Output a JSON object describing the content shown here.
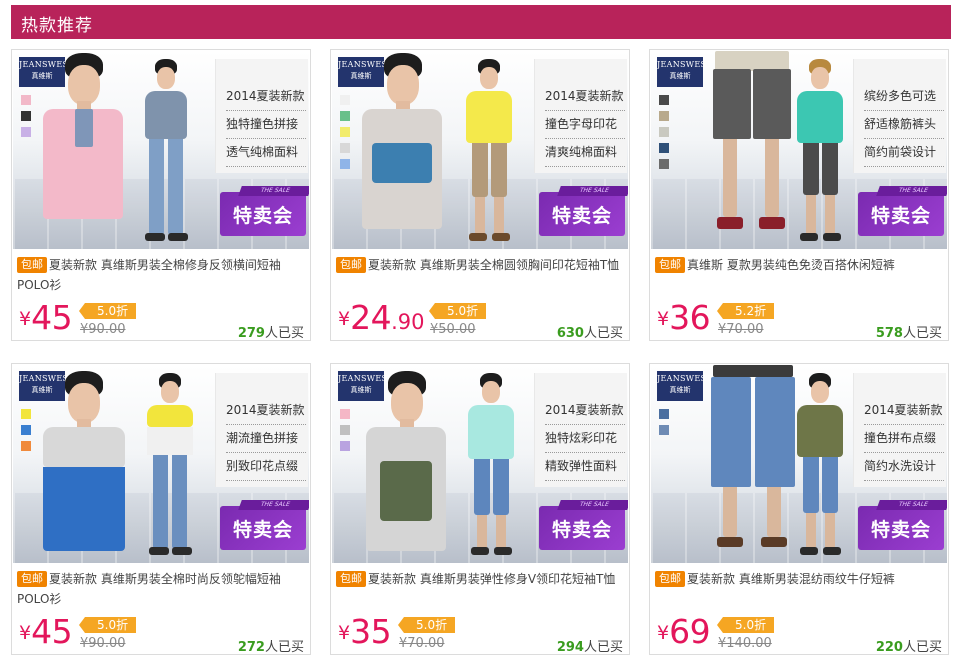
{
  "header": {
    "title": "热款推荐"
  },
  "brand": {
    "logo_line1": "JEANSWEST",
    "logo_line2": "真维斯"
  },
  "sale_badge": {
    "text": "特卖会",
    "ribbon": "THE SALE"
  },
  "products": [
    {
      "features": [
        "2014夏装新款",
        "独特撞色拼接",
        "透气纯棉面料"
      ],
      "free_shipping": "包邮",
      "title": "夏装新款 真维斯男装全棉修身反领横间短袖POLO衫",
      "price_int": "45",
      "price_dec": "",
      "currency": "¥",
      "discount": "5.0折",
      "original_price": "¥90.00",
      "sold_count": "279",
      "sold_suffix": "人已买",
      "swatches": [
        "#f2b8c8",
        "#333333",
        "#c8b0e6"
      ]
    },
    {
      "features": [
        "2014夏装新款",
        "撞色字母印花",
        "清爽纯棉面料"
      ],
      "free_shipping": "包邮",
      "title": "夏装新款 真维斯男装全棉圆领胸间印花短袖T恤",
      "price_int": "24",
      "price_dec": ".90",
      "currency": "¥",
      "discount": "5.0折",
      "original_price": "¥50.00",
      "sold_count": "630",
      "sold_suffix": "人已买",
      "swatches": [
        "#f0f0f0",
        "#69c08a",
        "#f2ec6b",
        "#d8d8d8",
        "#8fb4e8"
      ]
    },
    {
      "features": [
        "缤纷多色可选",
        "舒适橡筋裤头",
        "简约前袋设计"
      ],
      "free_shipping": "包邮",
      "title": "真维斯 夏款男装纯色免烫百搭休闲短裤",
      "price_int": "36",
      "price_dec": "",
      "currency": "¥",
      "discount": "5.2折",
      "original_price": "¥70.00",
      "sold_count": "578",
      "sold_suffix": "人已买",
      "swatches": [
        "#4a4a4a",
        "#b8a98c",
        "#c9c9c0",
        "#2f5078",
        "#6b6b6b"
      ]
    },
    {
      "features": [
        "2014夏装新款",
        "潮流撞色拼接",
        "别致印花点缀"
      ],
      "free_shipping": "包邮",
      "title": "夏装新款 真维斯男装全棉时尚反领鸵幅短袖POLO衫",
      "price_int": "45",
      "price_dec": "",
      "currency": "¥",
      "discount": "5.0折",
      "original_price": "¥90.00",
      "sold_count": "272",
      "sold_suffix": "人已买",
      "swatches": [
        "#f2e53c",
        "#3a7fd0",
        "#f08a3c"
      ]
    },
    {
      "features": [
        "2014夏装新款",
        "独特炫彩印花",
        "精致弹性面料"
      ],
      "free_shipping": "包邮",
      "title": "夏装新款 真维斯男装弹性修身V领印花短袖T恤",
      "price_int": "35",
      "price_dec": "",
      "currency": "¥",
      "discount": "5.0折",
      "original_price": "¥70.00",
      "sold_count": "294",
      "sold_suffix": "人已买",
      "swatches": [
        "#f5b7c6",
        "#c0c0c0",
        "#b9a3e0"
      ]
    },
    {
      "features": [
        "2014夏装新款",
        "撞色拼布点缀",
        "简约水洗设计"
      ],
      "free_shipping": "包邮",
      "title": "夏装新款 真维斯男装混纺雨纹牛仔短裤",
      "price_int": "69",
      "price_dec": "",
      "currency": "¥",
      "discount": "5.0折",
      "original_price": "¥140.00",
      "sold_count": "220",
      "sold_suffix": "人已买",
      "swatches": [
        "#4b6fa0",
        "#6e8bb4"
      ]
    }
  ],
  "colors": {
    "header_bg": "#b8235a",
    "price": "#e3165b",
    "discount_tag": "#f5a623",
    "free_tag": "#f08300",
    "sold_count": "#3a9c1f",
    "sale_purple": "#8a35c0"
  }
}
